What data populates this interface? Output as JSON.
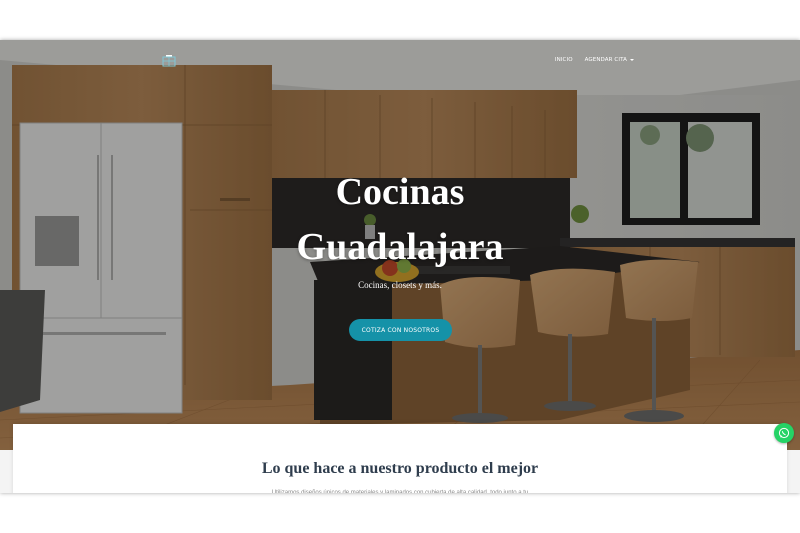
{
  "nav": {
    "items": [
      {
        "label": "INICIO"
      },
      {
        "label": "AGENDAR CITA"
      }
    ]
  },
  "hero": {
    "title_line1": "Cocinas",
    "title_line2": "Guadalajara",
    "subtitle": "Cocinas, closets y más.",
    "cta_label": "COTIZA CON NOSOTROS"
  },
  "section": {
    "title": "Lo que hace a nuestro producto el mejor",
    "text": "Utilizamos diseños únicos de materiales y laminados con cubierta de alta calidad, todo junto a tu"
  },
  "colors": {
    "accent": "#1592a8",
    "whatsapp": "#25d366",
    "heading": "#2f3d4d"
  },
  "icons": {
    "logo": "kitchen-logo-icon",
    "whatsapp": "whatsapp-icon",
    "dropdown": "caret-down-icon"
  }
}
